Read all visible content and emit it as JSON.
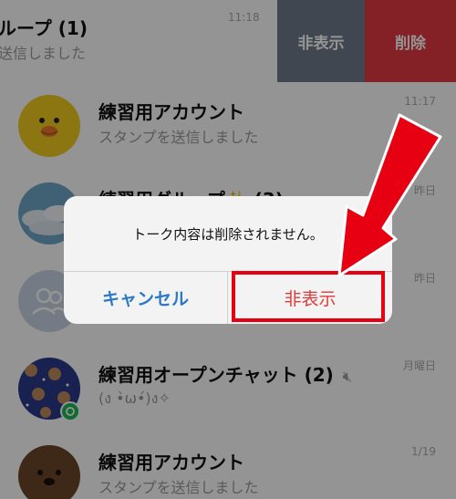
{
  "chats": [
    {
      "name": "ループ (1)",
      "preview": "送信しました",
      "time": "11:18",
      "avatar": "group-avatar"
    },
    {
      "name": "練習用アカウント",
      "preview": "スタンプを送信しました",
      "time": "11:17",
      "avatar": "sally-duck"
    },
    {
      "name": "練習用グループ✨ (3)",
      "preview": "",
      "time": "昨日",
      "avatar": "sky-photo"
    },
    {
      "name": "",
      "preview": "",
      "time": "昨日",
      "avatar": "default-group"
    },
    {
      "name": "練習用オープンチャット (2)",
      "preview": "(ง •̀ω•́)ง✧",
      "time": "月曜日",
      "avatar": "brown-pattern",
      "muted": true
    },
    {
      "name": "練習用アカウント",
      "preview": "スタンプを送信しました",
      "time": "1/19",
      "avatar": "brown-bear"
    }
  ],
  "swipe_actions": {
    "hide_label": "非表示",
    "delete_label": "削除"
  },
  "dialog": {
    "message": "トーク内容は削除されません。",
    "cancel_label": "キャンセル",
    "hide_label": "非表示"
  },
  "icons": {
    "mute": "mute-speaker-icon"
  },
  "colors": {
    "hide_action": "#6e7a8a",
    "delete_action": "#e23a44",
    "annotation": "#e60012",
    "cancel_text": "#2b78c9"
  }
}
